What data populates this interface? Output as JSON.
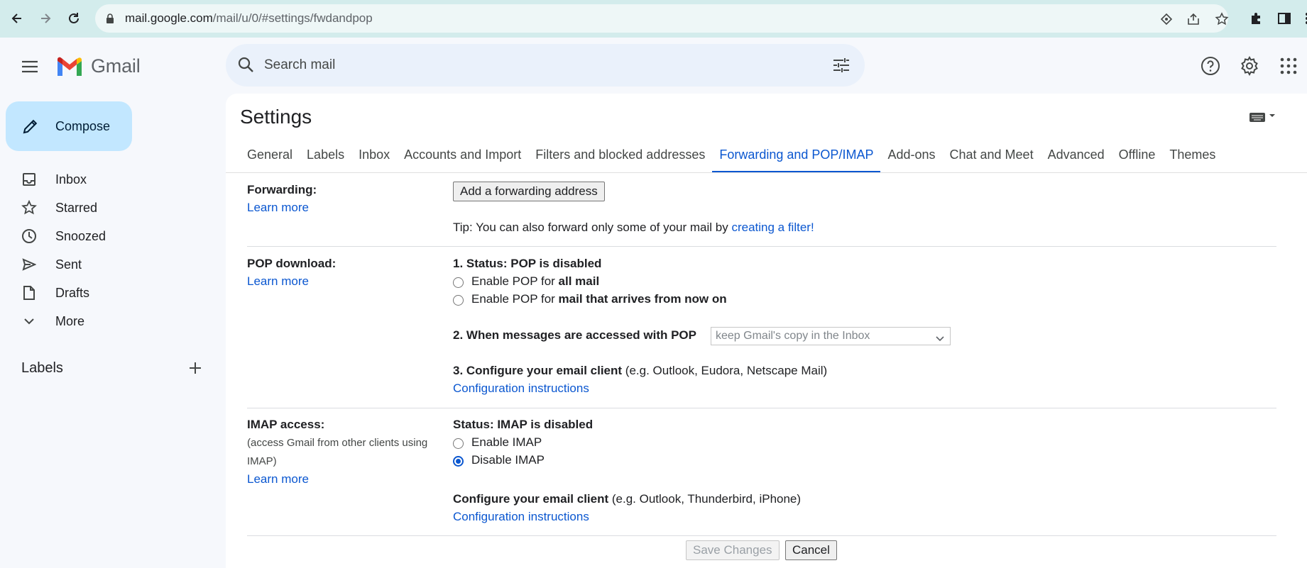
{
  "browser": {
    "url_host": "mail.google.com",
    "url_path": "/mail/u/0/#settings/fwdandpop"
  },
  "header": {
    "logo_text": "Gmail",
    "search_placeholder": "Search mail"
  },
  "sidebar": {
    "compose_label": "Compose",
    "items": [
      {
        "label": "Inbox",
        "icon": "inbox-icon"
      },
      {
        "label": "Starred",
        "icon": "star-icon"
      },
      {
        "label": "Snoozed",
        "icon": "clock-icon"
      },
      {
        "label": "Sent",
        "icon": "send-icon"
      },
      {
        "label": "Drafts",
        "icon": "draft-icon"
      },
      {
        "label": "More",
        "icon": "chevron-down-icon"
      }
    ],
    "labels_heading": "Labels"
  },
  "settings": {
    "title": "Settings",
    "tabs": [
      "General",
      "Labels",
      "Inbox",
      "Accounts and Import",
      "Filters and blocked addresses",
      "Forwarding and POP/IMAP",
      "Add-ons",
      "Chat and Meet",
      "Advanced",
      "Offline",
      "Themes"
    ],
    "active_tab": "Forwarding and POP/IMAP",
    "learn_more": "Learn more",
    "forwarding": {
      "label": "Forwarding:",
      "add_button": "Add a forwarding address",
      "tip_prefix": "Tip: You can also forward only some of your mail by ",
      "tip_link": "creating a filter!"
    },
    "pop": {
      "label": "POP download:",
      "status": "1. Status: POP is disabled",
      "opt1_prefix": "Enable POP for ",
      "opt1_bold": "all mail",
      "opt2_prefix": "Enable POP for ",
      "opt2_bold": "mail that arrives from now on",
      "when_label": "2. When messages are accessed with POP",
      "when_value": "keep Gmail's copy in the Inbox",
      "configure_bold": "3. Configure your email client",
      "configure_rest": " (e.g. Outlook, Eudora, Netscape Mail)",
      "config_link": "Configuration instructions"
    },
    "imap": {
      "label": "IMAP access:",
      "sub": "(access Gmail from other clients using IMAP)",
      "status": "Status: IMAP is disabled",
      "enable": "Enable IMAP",
      "disable": "Disable IMAP",
      "configure_bold": "Configure your email client",
      "configure_rest": " (e.g. Outlook, Thunderbird, iPhone)",
      "config_link": "Configuration instructions"
    },
    "save_label": "Save Changes",
    "cancel_label": "Cancel"
  },
  "colors": {
    "accent": "#0b57d0",
    "compose_bg": "#c2e7ff",
    "chrome_bg": "#d3ecec"
  }
}
